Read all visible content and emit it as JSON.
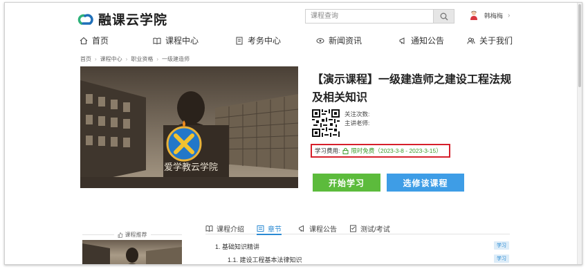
{
  "brand": {
    "name": "融课云学院",
    "logo_icon": "cloud-logo-icon",
    "accent": "#2fb27a"
  },
  "search": {
    "placeholder": "课程查询"
  },
  "user": {
    "name": "韩梅梅"
  },
  "nav": [
    {
      "label": "首页",
      "icon": "home-icon"
    },
    {
      "label": "课程中心",
      "icon": "book-icon"
    },
    {
      "label": "考务中心",
      "icon": "exam-icon"
    },
    {
      "label": "新闻资讯",
      "icon": "news-icon"
    },
    {
      "label": "通知公告",
      "icon": "megaphone-icon"
    },
    {
      "label": "关于我们",
      "icon": "about-icon"
    }
  ],
  "breadcrumb": [
    "首页",
    "课程中心",
    "职业资格",
    "一级建造师"
  ],
  "course": {
    "title": "【演示课程】一级建造师之建设工程法规及相关知识",
    "hero_caption": "爱学教云学院",
    "meta_views_label": "关注次数:",
    "meta_teacher_label": "主讲老师:",
    "fee_label": "学习费用:",
    "fee_value": "限时免费（2023-3-8 - 2023-3-15）",
    "start_label": "开始学习",
    "elect_label": "选修该课程",
    "colors": {
      "fee_border": "#d61f2b",
      "free_text": "#3f9b2e",
      "start_bg": "#5cbb3c",
      "elect_bg": "#3e9de6"
    }
  },
  "tabs": [
    {
      "label": "课程介绍",
      "icon": "intro-icon",
      "active": false
    },
    {
      "label": "章节",
      "icon": "chapter-icon",
      "active": true
    },
    {
      "label": "课程公告",
      "icon": "notice-icon",
      "active": false
    },
    {
      "label": "测试/考试",
      "icon": "test-icon",
      "active": false
    }
  ],
  "recommend": {
    "title": "课程推荐"
  },
  "chapters": [
    {
      "label": "1.   基础知识精讲",
      "tag": "学习"
    },
    {
      "label": "1.1.   建设工程基本法律知识",
      "tag": "学习"
    }
  ]
}
